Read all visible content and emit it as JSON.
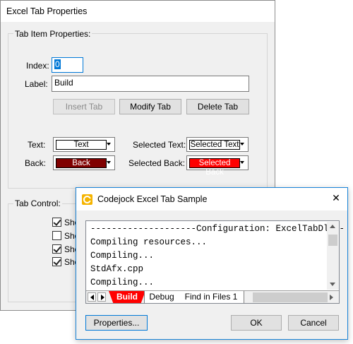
{
  "tab_dialog": {
    "title": "Excel Tab Properties",
    "tab_item_group": {
      "label": "Tab Item Properties:",
      "index_label": "Index:",
      "index_value": "0",
      "label_label": "Label:",
      "label_value": "Build",
      "insert_button": "Insert Tab",
      "modify_button": "Modify Tab",
      "delete_button": "Delete Tab",
      "text_label": "Text:",
      "text_swatch": "Text",
      "selected_text_label": "Selected Text:",
      "selected_text_swatch": "Selected Text",
      "back_label": "Back:",
      "back_swatch": "Back",
      "selected_back_label": "Selected Back:",
      "selected_back_swatch": "Selected Back",
      "colors": {
        "text_fg": "#000000",
        "text_bg": "#ffffff",
        "selected_text_bg": "#ffffff",
        "back_bg": "#800000",
        "back_fg": "#ffffff",
        "selected_back_bg": "#ff0000",
        "selected_back_fg": "#ffffff"
      }
    },
    "tab_control_group": {
      "label": "Tab Control:",
      "checkboxes": [
        {
          "label": "Sho",
          "checked": true
        },
        {
          "label": "Sho",
          "checked": false
        },
        {
          "label": "Sho",
          "checked": true
        },
        {
          "label": "Sho",
          "checked": true
        }
      ]
    }
  },
  "sample_dialog": {
    "title": "Codejock Excel Tab Sample",
    "close_glyph": "✕",
    "output_lines": [
      "--------------------Configuration: ExcelTabDlg -",
      "Compiling resources...",
      "Compiling...",
      "StdAfx.cpp",
      "Compiling..."
    ],
    "tabs": [
      {
        "label": "Build",
        "selected": true
      },
      {
        "label": "Debug",
        "selected": false
      },
      {
        "label": "Find in Files 1",
        "selected": false
      }
    ],
    "properties_button": "Properties...",
    "ok_button": "OK",
    "cancel_button": "Cancel",
    "accent_color": "#ff0000"
  }
}
